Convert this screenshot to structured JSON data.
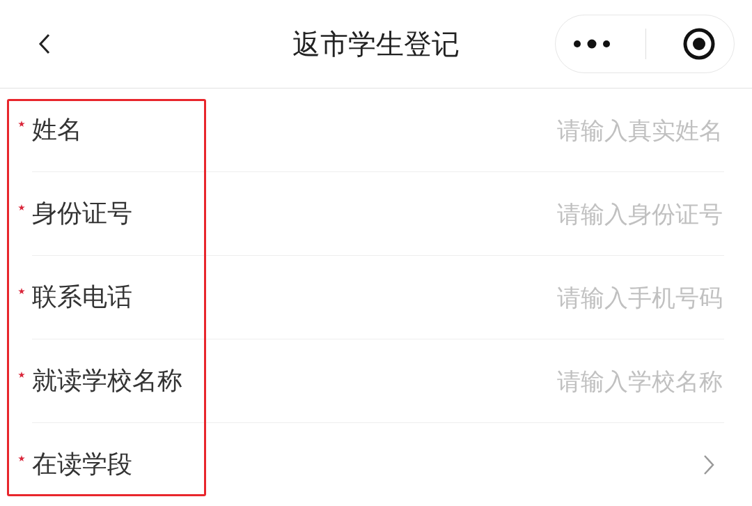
{
  "nav_bar": {
    "title": "返市学生登记"
  },
  "form": {
    "fields": [
      {
        "kind": "input",
        "label": "姓名",
        "required": true,
        "placeholder": "请输入真实姓名"
      },
      {
        "kind": "input",
        "label": "身份证号",
        "required": true,
        "placeholder": "请输入身份证号"
      },
      {
        "kind": "input",
        "label": "联系电话",
        "required": true,
        "placeholder": "请输入手机号码"
      },
      {
        "kind": "input",
        "label": "就读学校名称",
        "required": true,
        "placeholder": "请输入学校名称"
      },
      {
        "kind": "picker",
        "label": "在读学段",
        "required": true
      }
    ]
  },
  "annotation": {
    "kind": "rectangle"
  }
}
